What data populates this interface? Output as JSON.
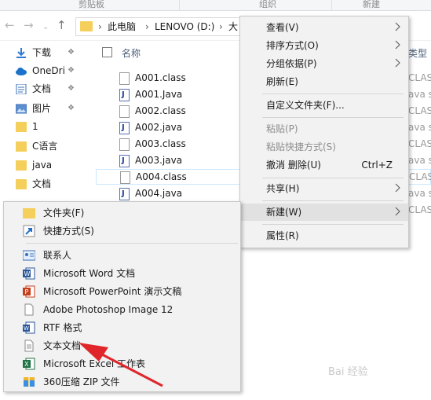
{
  "ribbon": {
    "groups": [
      "剪贴板",
      "组织",
      "新建"
    ]
  },
  "nav": {
    "back_icon": "arrow-left-icon",
    "forward_icon": "arrow-right-icon",
    "dropdown_icon": "chevron-down-icon",
    "up_icon": "arrow-up-icon",
    "breadcrumb": [
      "此电脑",
      "LENOVO (D:)",
      "大"
    ]
  },
  "sidebar": {
    "items": [
      {
        "label": "下载",
        "icon": "download-icon"
      },
      {
        "label": "OneDri",
        "icon": "cloud-icon"
      },
      {
        "label": "文档",
        "icon": "document-icon"
      },
      {
        "label": "图片",
        "icon": "picture-icon"
      },
      {
        "label": "1",
        "icon": "folder-icon"
      },
      {
        "label": "C语言",
        "icon": "folder-icon"
      },
      {
        "label": "java",
        "icon": "folder-icon"
      },
      {
        "label": "文档",
        "icon": "folder-icon"
      }
    ]
  },
  "filelist": {
    "header_name": "名称",
    "header_type": "类型",
    "files": [
      {
        "name": "A001.class",
        "type": "CLASS"
      },
      {
        "name": "A001.Java",
        "type": "ava s"
      },
      {
        "name": "A002.class",
        "type": "CLASS"
      },
      {
        "name": "A002.java",
        "type": "ava s"
      },
      {
        "name": "A003.class",
        "type": "CLASS"
      },
      {
        "name": "A003.java",
        "type": "ava s"
      },
      {
        "name": "A004.class",
        "type": "CLASS"
      },
      {
        "name": "A004.java",
        "type": "ava s"
      },
      {
        "name": "",
        "type": "CLASS"
      }
    ]
  },
  "context_menu": {
    "view": "查看(V)",
    "sort": "排序方式(O)",
    "group": "分组依据(P)",
    "refresh": "刷新(E)",
    "customize": "自定义文件夹(F)...",
    "paste": "粘贴(P)",
    "paste_shortcut": "粘贴快捷方式(S)",
    "undo": "撤消 删除(U)",
    "undo_shortcut": "Ctrl+Z",
    "share": "共享(H)",
    "new": "新建(W)",
    "properties": "属性(R)"
  },
  "new_submenu": {
    "items": [
      {
        "label": "文件夹(F)",
        "icon": "folder-icon"
      },
      {
        "label": "快捷方式(S)",
        "icon": "shortcut-icon"
      },
      {
        "label": "联系人",
        "icon": "contact-card-icon"
      },
      {
        "label": "Microsoft Word 文档",
        "icon": "word-icon"
      },
      {
        "label": "Microsoft PowerPoint 演示文稿",
        "icon": "powerpoint-icon"
      },
      {
        "label": "Adobe Photoshop Image 12",
        "icon": "blank-file-icon"
      },
      {
        "label": "RTF 格式",
        "icon": "rtf-icon"
      },
      {
        "label": "文本文档",
        "icon": "text-document-icon"
      },
      {
        "label": "Microsoft Excel 工作表",
        "icon": "excel-icon"
      },
      {
        "label": "360压缩 ZIP 文件",
        "icon": "zip-archive-icon"
      }
    ]
  },
  "watermark": "Bai 经验"
}
